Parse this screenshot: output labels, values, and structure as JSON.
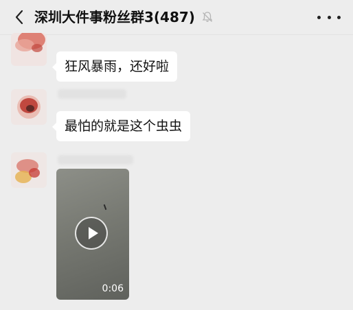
{
  "header": {
    "title": "深圳大件事粉丝群3(487)",
    "back_icon": "back-arrow-icon",
    "mute_icon": "muted-bell-icon",
    "more_icon": "more-dots-icon"
  },
  "messages": [
    {
      "type": "text",
      "text": "狂风暴雨，还好啦"
    },
    {
      "type": "text",
      "text": "最怕的就是这个虫虫"
    },
    {
      "type": "video",
      "duration": "0:06",
      "play_icon": "play-icon"
    }
  ],
  "colors": {
    "background": "#ededed",
    "bubble": "#ffffff",
    "text": "#111111"
  }
}
